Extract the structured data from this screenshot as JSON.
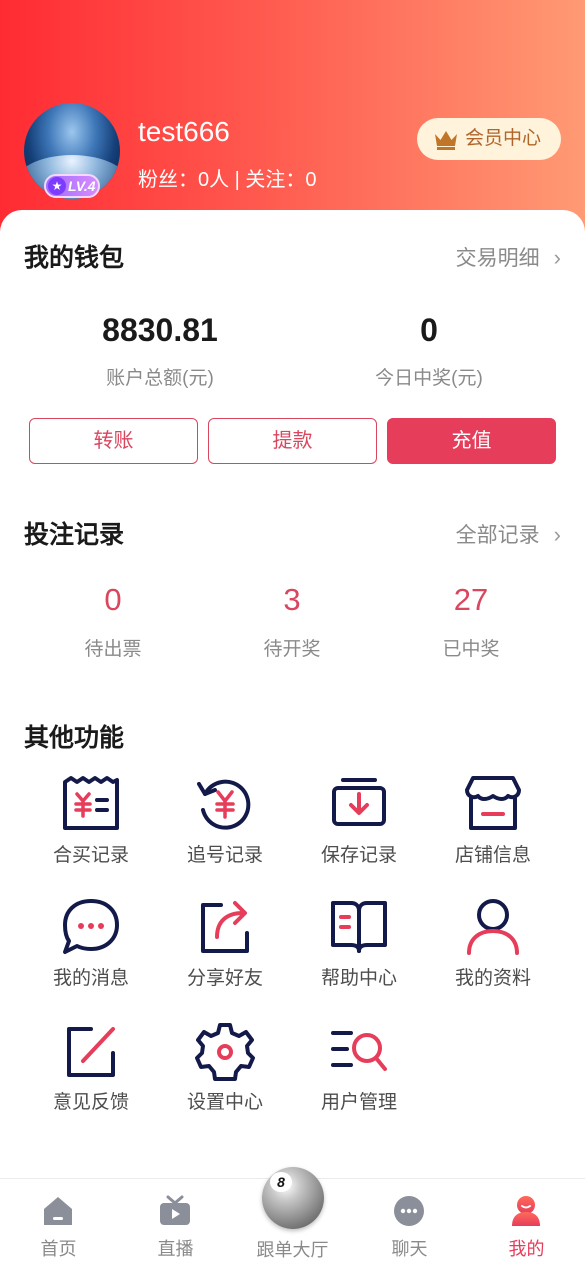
{
  "profile": {
    "username": "test666",
    "level": "LV.4",
    "follow_text": "粉丝：0人 | 关注：0",
    "vip_label": "会员中心"
  },
  "wallet": {
    "title": "我的钱包",
    "link": "交易明细",
    "balance_value": "8830.81",
    "balance_label": "账户总额(元)",
    "today_value": "0",
    "today_label": "今日中奖(元)",
    "buttons": [
      "转账",
      "提款",
      "充值"
    ]
  },
  "bets": {
    "title": "投注记录",
    "link": "全部记录",
    "items": [
      {
        "value": "0",
        "label": "待出票"
      },
      {
        "value": "3",
        "label": "待开奖"
      },
      {
        "value": "27",
        "label": "已中奖"
      }
    ]
  },
  "functions": {
    "title": "其他功能",
    "items": [
      {
        "label": "合买记录",
        "icon": "receipt-yen-icon"
      },
      {
        "label": "追号记录",
        "icon": "yen-history-icon"
      },
      {
        "label": "保存记录",
        "icon": "download-box-icon"
      },
      {
        "label": "店铺信息",
        "icon": "store-icon"
      },
      {
        "label": "我的消息",
        "icon": "message-bubble-icon"
      },
      {
        "label": "分享好友",
        "icon": "share-icon"
      },
      {
        "label": "帮助中心",
        "icon": "book-icon"
      },
      {
        "label": "我的资料",
        "icon": "user-icon"
      },
      {
        "label": "意见反馈",
        "icon": "edit-icon"
      },
      {
        "label": "设置中心",
        "icon": "gear-icon"
      },
      {
        "label": "用户管理",
        "icon": "list-search-icon"
      }
    ]
  },
  "tabbar": {
    "items": [
      {
        "label": "首页",
        "icon": "home-icon"
      },
      {
        "label": "直播",
        "icon": "tv-icon"
      },
      {
        "label": "跟单大厅",
        "icon": "eight-ball-icon"
      },
      {
        "label": "聊天",
        "icon": "chat-icon"
      },
      {
        "label": "我的",
        "icon": "profile-icon",
        "active": true
      }
    ]
  },
  "colors": {
    "accent": "#e63d5b",
    "icon_dark": "#131a4a",
    "header_start": "#ff2b33",
    "header_end": "#ff9a74"
  }
}
